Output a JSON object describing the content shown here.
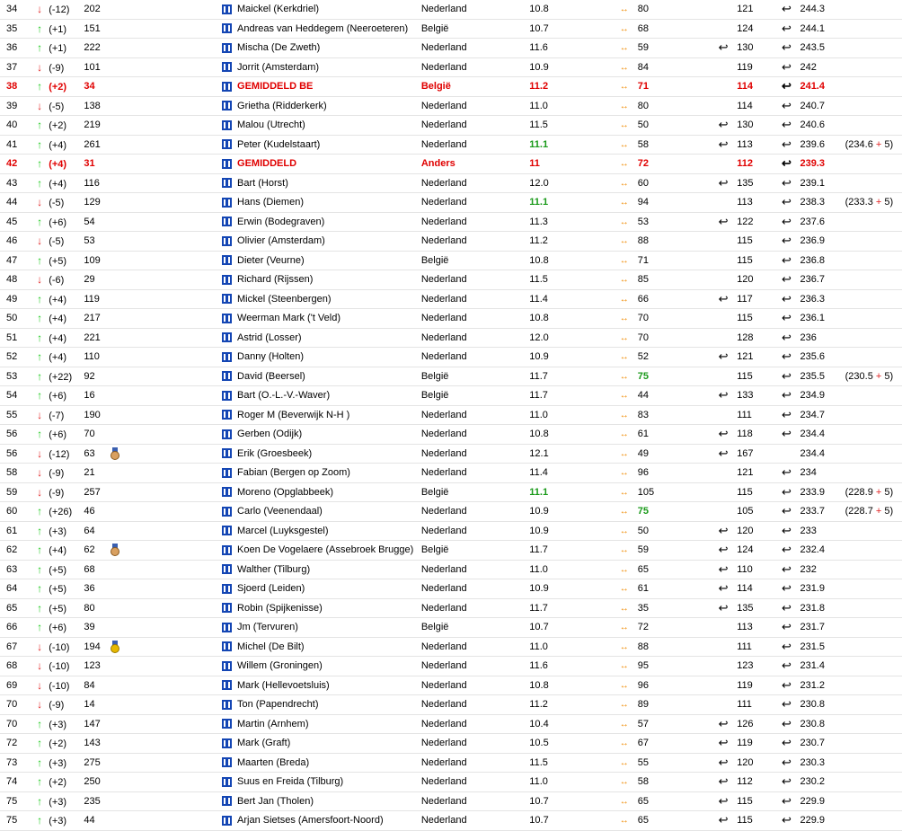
{
  "colors": {
    "up": "#19c819",
    "down": "#e02020",
    "highlight": "#e00000",
    "flag": "#1446b4",
    "swap": "#f08a00",
    "green_score": "#1a9a1a"
  },
  "icons": {
    "up": "↑",
    "down": "↓",
    "swap": "↔",
    "return": "↩"
  },
  "rows": [
    {
      "rank": "34",
      "dir": "down",
      "move": "(-12)",
      "id": "202",
      "medal": "",
      "name": "Maickel (Kerkdriel)",
      "country": "Nederland",
      "score": "10.8",
      "green": false,
      "v1": "80",
      "v1g": false,
      "r1": "",
      "v2": "121",
      "r2": "↩",
      "total": "244.3",
      "extra": "",
      "extra2": "",
      "hl": false
    },
    {
      "rank": "35",
      "dir": "up",
      "move": "(+1)",
      "id": "151",
      "medal": "",
      "name": "Andreas van Heddegem (Neeroeteren)",
      "country": "België",
      "score": "10.7",
      "green": false,
      "v1": "68",
      "v1g": false,
      "r1": "",
      "v2": "124",
      "r2": "↩",
      "total": "244.1",
      "extra": "",
      "extra2": "",
      "hl": false
    },
    {
      "rank": "36",
      "dir": "up",
      "move": "(+1)",
      "id": "222",
      "medal": "",
      "name": "Mischa (De Zweth)",
      "country": "Nederland",
      "score": "11.6",
      "green": false,
      "v1": "59",
      "v1g": false,
      "r1": "↩",
      "v2": "130",
      "r2": "↩",
      "total": "243.5",
      "extra": "",
      "extra2": "",
      "hl": false
    },
    {
      "rank": "37",
      "dir": "down",
      "move": "(-9)",
      "id": "101",
      "medal": "",
      "name": "Jorrit (Amsterdam)",
      "country": "Nederland",
      "score": "10.9",
      "green": false,
      "v1": "84",
      "v1g": false,
      "r1": "",
      "v2": "119",
      "r2": "↩",
      "total": "242",
      "extra": "",
      "extra2": "",
      "hl": false
    },
    {
      "rank": "38",
      "dir": "up",
      "move": "(+2)",
      "id": "34",
      "medal": "",
      "name": "GEMIDDELD BE",
      "country": "België",
      "score": "11.2",
      "green": false,
      "v1": "71",
      "v1g": false,
      "r1": "",
      "v2": "114",
      "r2": "↩",
      "total": "241.4",
      "extra": "",
      "extra2": "",
      "hl": true
    },
    {
      "rank": "39",
      "dir": "down",
      "move": "(-5)",
      "id": "138",
      "medal": "",
      "name": "Grietha (Ridderkerk)",
      "country": "Nederland",
      "score": "11.0",
      "green": false,
      "v1": "80",
      "v1g": false,
      "r1": "",
      "v2": "114",
      "r2": "↩",
      "total": "240.7",
      "extra": "",
      "extra2": "",
      "hl": false
    },
    {
      "rank": "40",
      "dir": "up",
      "move": "(+2)",
      "id": "219",
      "medal": "",
      "name": "Malou (Utrecht)",
      "country": "Nederland",
      "score": "11.5",
      "green": false,
      "v1": "50",
      "v1g": false,
      "r1": "↩",
      "v2": "130",
      "r2": "↩",
      "total": "240.6",
      "extra": "",
      "extra2": "",
      "hl": false
    },
    {
      "rank": "41",
      "dir": "up",
      "move": "(+4)",
      "id": "261",
      "medal": "",
      "name": "Peter (Kudelstaart)",
      "country": "Nederland",
      "score": "11.1",
      "green": true,
      "v1": "58",
      "v1g": false,
      "r1": "↩",
      "v2": "113",
      "r2": "↩",
      "total": "239.6",
      "extra": "(234.6",
      "extra2": "5)",
      "hl": false
    },
    {
      "rank": "42",
      "dir": "up",
      "move": "(+4)",
      "id": "31",
      "medal": "",
      "name": "GEMIDDELD",
      "country": "Anders",
      "score": "11",
      "green": false,
      "v1": "72",
      "v1g": false,
      "r1": "",
      "v2": "112",
      "r2": "↩",
      "total": "239.3",
      "extra": "",
      "extra2": "",
      "hl": true
    },
    {
      "rank": "43",
      "dir": "up",
      "move": "(+4)",
      "id": "116",
      "medal": "",
      "name": "Bart (Horst)",
      "country": "Nederland",
      "score": "12.0",
      "green": false,
      "v1": "60",
      "v1g": false,
      "r1": "↩",
      "v2": "135",
      "r2": "↩",
      "total": "239.1",
      "extra": "",
      "extra2": "",
      "hl": false
    },
    {
      "rank": "44",
      "dir": "down",
      "move": "(-5)",
      "id": "129",
      "medal": "",
      "name": "Hans (Diemen)",
      "country": "Nederland",
      "score": "11.1",
      "green": true,
      "v1": "94",
      "v1g": false,
      "r1": "",
      "v2": "113",
      "r2": "↩",
      "total": "238.3",
      "extra": "(233.3",
      "extra2": "5)",
      "hl": false
    },
    {
      "rank": "45",
      "dir": "up",
      "move": "(+6)",
      "id": "54",
      "medal": "",
      "name": "Erwin (Bodegraven)",
      "country": "Nederland",
      "score": "11.3",
      "green": false,
      "v1": "53",
      "v1g": false,
      "r1": "↩",
      "v2": "122",
      "r2": "↩",
      "total": "237.6",
      "extra": "",
      "extra2": "",
      "hl": false
    },
    {
      "rank": "46",
      "dir": "down",
      "move": "(-5)",
      "id": "53",
      "medal": "",
      "name": "Olivier (Amsterdam)",
      "country": "Nederland",
      "score": "11.2",
      "green": false,
      "v1": "88",
      "v1g": false,
      "r1": "",
      "v2": "115",
      "r2": "↩",
      "total": "236.9",
      "extra": "",
      "extra2": "",
      "hl": false
    },
    {
      "rank": "47",
      "dir": "up",
      "move": "(+5)",
      "id": "109",
      "medal": "",
      "name": "Dieter (Veurne)",
      "country": "België",
      "score": "10.8",
      "green": false,
      "v1": "71",
      "v1g": false,
      "r1": "",
      "v2": "115",
      "r2": "↩",
      "total": "236.8",
      "extra": "",
      "extra2": "",
      "hl": false
    },
    {
      "rank": "48",
      "dir": "down",
      "move": "(-6)",
      "id": "29",
      "medal": "",
      "name": "Richard (Rijssen)",
      "country": "Nederland",
      "score": "11.5",
      "green": false,
      "v1": "85",
      "v1g": false,
      "r1": "",
      "v2": "120",
      "r2": "↩",
      "total": "236.7",
      "extra": "",
      "extra2": "",
      "hl": false
    },
    {
      "rank": "49",
      "dir": "up",
      "move": "(+4)",
      "id": "119",
      "medal": "",
      "name": "Mickel (Steenbergen)",
      "country": "Nederland",
      "score": "11.4",
      "green": false,
      "v1": "66",
      "v1g": false,
      "r1": "↩",
      "v2": "117",
      "r2": "↩",
      "total": "236.3",
      "extra": "",
      "extra2": "",
      "hl": false
    },
    {
      "rank": "50",
      "dir": "up",
      "move": "(+4)",
      "id": "217",
      "medal": "",
      "name": "Weerman Mark ('t Veld)",
      "country": "Nederland",
      "score": "10.8",
      "green": false,
      "v1": "70",
      "v1g": false,
      "r1": "",
      "v2": "115",
      "r2": "↩",
      "total": "236.1",
      "extra": "",
      "extra2": "",
      "hl": false
    },
    {
      "rank": "51",
      "dir": "up",
      "move": "(+4)",
      "id": "221",
      "medal": "",
      "name": "Astrid (Losser)",
      "country": "Nederland",
      "score": "12.0",
      "green": false,
      "v1": "70",
      "v1g": false,
      "r1": "",
      "v2": "128",
      "r2": "↩",
      "total": "236",
      "extra": "",
      "extra2": "",
      "hl": false
    },
    {
      "rank": "52",
      "dir": "up",
      "move": "(+4)",
      "id": "110",
      "medal": "",
      "name": "Danny (Holten)",
      "country": "Nederland",
      "score": "10.9",
      "green": false,
      "v1": "52",
      "v1g": false,
      "r1": "↩",
      "v2": "121",
      "r2": "↩",
      "total": "235.6",
      "extra": "",
      "extra2": "",
      "hl": false
    },
    {
      "rank": "53",
      "dir": "up",
      "move": "(+22)",
      "id": "92",
      "medal": "",
      "name": "David (Beersel)",
      "country": "België",
      "score": "11.7",
      "green": false,
      "v1": "75",
      "v1g": true,
      "r1": "",
      "v2": "115",
      "r2": "↩",
      "total": "235.5",
      "extra": "(230.5",
      "extra2": "5)",
      "hl": false
    },
    {
      "rank": "54",
      "dir": "up",
      "move": "(+6)",
      "id": "16",
      "medal": "",
      "name": "Bart (O.-L.-V.-Waver)",
      "country": "België",
      "score": "11.7",
      "green": false,
      "v1": "44",
      "v1g": false,
      "r1": "↩",
      "v2": "133",
      "r2": "↩",
      "total": "234.9",
      "extra": "",
      "extra2": "",
      "hl": false
    },
    {
      "rank": "55",
      "dir": "down",
      "move": "(-7)",
      "id": "190",
      "medal": "",
      "name": "Roger M (Beverwijk N-H )",
      "country": "Nederland",
      "score": "11.0",
      "green": false,
      "v1": "83",
      "v1g": false,
      "r1": "",
      "v2": "111",
      "r2": "↩",
      "total": "234.7",
      "extra": "",
      "extra2": "",
      "hl": false
    },
    {
      "rank": "56",
      "dir": "up",
      "move": "(+6)",
      "id": "70",
      "medal": "",
      "name": "Gerben (Odijk)",
      "country": "Nederland",
      "score": "10.8",
      "green": false,
      "v1": "61",
      "v1g": false,
      "r1": "↩",
      "v2": "118",
      "r2": "↩",
      "total": "234.4",
      "extra": "",
      "extra2": "",
      "hl": false
    },
    {
      "rank": "56",
      "dir": "down",
      "move": "(-12)",
      "id": "63",
      "medal": "bronze",
      "name": "Erik (Groesbeek)",
      "country": "Nederland",
      "score": "12.1",
      "green": false,
      "v1": "49",
      "v1g": false,
      "r1": "↩",
      "v2": "167",
      "r2": "",
      "total": "234.4",
      "extra": "",
      "extra2": "",
      "hl": false
    },
    {
      "rank": "58",
      "dir": "down",
      "move": "(-9)",
      "id": "21",
      "medal": "",
      "name": "Fabian (Bergen op Zoom)",
      "country": "Nederland",
      "score": "11.4",
      "green": false,
      "v1": "96",
      "v1g": false,
      "r1": "",
      "v2": "121",
      "r2": "↩",
      "total": "234",
      "extra": "",
      "extra2": "",
      "hl": false
    },
    {
      "rank": "59",
      "dir": "down",
      "move": "(-9)",
      "id": "257",
      "medal": "",
      "name": "Moreno (Opglabbeek)",
      "country": "België",
      "score": "11.1",
      "green": true,
      "v1": "105",
      "v1g": false,
      "r1": "",
      "v2": "115",
      "r2": "↩",
      "total": "233.9",
      "extra": "(228.9",
      "extra2": "5)",
      "hl": false
    },
    {
      "rank": "60",
      "dir": "up",
      "move": "(+26)",
      "id": "46",
      "medal": "",
      "name": "Carlo (Veenendaal)",
      "country": "Nederland",
      "score": "10.9",
      "green": false,
      "v1": "75",
      "v1g": true,
      "r1": "",
      "v2": "105",
      "r2": "↩",
      "total": "233.7",
      "extra": "(228.7",
      "extra2": "5)",
      "hl": false
    },
    {
      "rank": "61",
      "dir": "up",
      "move": "(+3)",
      "id": "64",
      "medal": "",
      "name": "Marcel (Luyksgestel)",
      "country": "Nederland",
      "score": "10.9",
      "green": false,
      "v1": "50",
      "v1g": false,
      "r1": "↩",
      "v2": "120",
      "r2": "↩",
      "total": "233",
      "extra": "",
      "extra2": "",
      "hl": false
    },
    {
      "rank": "62",
      "dir": "up",
      "move": "(+4)",
      "id": "62",
      "medal": "bronze",
      "name": "Koen De Vogelaere (Assebroek Brugge)",
      "country": "België",
      "score": "11.7",
      "green": false,
      "v1": "59",
      "v1g": false,
      "r1": "↩",
      "v2": "124",
      "r2": "↩",
      "total": "232.4",
      "extra": "",
      "extra2": "",
      "hl": false
    },
    {
      "rank": "63",
      "dir": "up",
      "move": "(+5)",
      "id": "68",
      "medal": "",
      "name": "Walther (Tilburg)",
      "country": "Nederland",
      "score": "11.0",
      "green": false,
      "v1": "65",
      "v1g": false,
      "r1": "↩",
      "v2": "110",
      "r2": "↩",
      "total": "232",
      "extra": "",
      "extra2": "",
      "hl": false
    },
    {
      "rank": "64",
      "dir": "up",
      "move": "(+5)",
      "id": "36",
      "medal": "",
      "name": "Sjoerd (Leiden)",
      "country": "Nederland",
      "score": "10.9",
      "green": false,
      "v1": "61",
      "v1g": false,
      "r1": "↩",
      "v2": "114",
      "r2": "↩",
      "total": "231.9",
      "extra": "",
      "extra2": "",
      "hl": false
    },
    {
      "rank": "65",
      "dir": "up",
      "move": "(+5)",
      "id": "80",
      "medal": "",
      "name": "Robin (Spijkenisse)",
      "country": "Nederland",
      "score": "11.7",
      "green": false,
      "v1": "35",
      "v1g": false,
      "r1": "↩",
      "v2": "135",
      "r2": "↩",
      "total": "231.8",
      "extra": "",
      "extra2": "",
      "hl": false
    },
    {
      "rank": "66",
      "dir": "up",
      "move": "(+6)",
      "id": "39",
      "medal": "",
      "name": "Jm (Tervuren)",
      "country": "België",
      "score": "10.7",
      "green": false,
      "v1": "72",
      "v1g": false,
      "r1": "",
      "v2": "113",
      "r2": "↩",
      "total": "231.7",
      "extra": "",
      "extra2": "",
      "hl": false
    },
    {
      "rank": "67",
      "dir": "down",
      "move": "(-10)",
      "id": "194",
      "medal": "gold",
      "name": "Michel (De Bilt)",
      "country": "Nederland",
      "score": "11.0",
      "green": false,
      "v1": "88",
      "v1g": false,
      "r1": "",
      "v2": "111",
      "r2": "↩",
      "total": "231.5",
      "extra": "",
      "extra2": "",
      "hl": false
    },
    {
      "rank": "68",
      "dir": "down",
      "move": "(-10)",
      "id": "123",
      "medal": "",
      "name": "Willem (Groningen)",
      "country": "Nederland",
      "score": "11.6",
      "green": false,
      "v1": "95",
      "v1g": false,
      "r1": "",
      "v2": "123",
      "r2": "↩",
      "total": "231.4",
      "extra": "",
      "extra2": "",
      "hl": false
    },
    {
      "rank": "69",
      "dir": "down",
      "move": "(-10)",
      "id": "84",
      "medal": "",
      "name": "Mark (Hellevoetsluis)",
      "country": "Nederland",
      "score": "10.8",
      "green": false,
      "v1": "96",
      "v1g": false,
      "r1": "",
      "v2": "119",
      "r2": "↩",
      "total": "231.2",
      "extra": "",
      "extra2": "",
      "hl": false
    },
    {
      "rank": "70",
      "dir": "down",
      "move": "(-9)",
      "id": "14",
      "medal": "",
      "name": "Ton (Papendrecht)",
      "country": "Nederland",
      "score": "11.2",
      "green": false,
      "v1": "89",
      "v1g": false,
      "r1": "",
      "v2": "111",
      "r2": "↩",
      "total": "230.8",
      "extra": "",
      "extra2": "",
      "hl": false
    },
    {
      "rank": "70",
      "dir": "up",
      "move": "(+3)",
      "id": "147",
      "medal": "",
      "name": "Martin (Arnhem)",
      "country": "Nederland",
      "score": "10.4",
      "green": false,
      "v1": "57",
      "v1g": false,
      "r1": "↩",
      "v2": "126",
      "r2": "↩",
      "total": "230.8",
      "extra": "",
      "extra2": "",
      "hl": false
    },
    {
      "rank": "72",
      "dir": "up",
      "move": "(+2)",
      "id": "143",
      "medal": "",
      "name": "Mark (Graft)",
      "country": "Nederland",
      "score": "10.5",
      "green": false,
      "v1": "67",
      "v1g": false,
      "r1": "↩",
      "v2": "119",
      "r2": "↩",
      "total": "230.7",
      "extra": "",
      "extra2": "",
      "hl": false
    },
    {
      "rank": "73",
      "dir": "up",
      "move": "(+3)",
      "id": "275",
      "medal": "",
      "name": "Maarten (Breda)",
      "country": "Nederland",
      "score": "11.5",
      "green": false,
      "v1": "55",
      "v1g": false,
      "r1": "↩",
      "v2": "120",
      "r2": "↩",
      "total": "230.3",
      "extra": "",
      "extra2": "",
      "hl": false
    },
    {
      "rank": "74",
      "dir": "up",
      "move": "(+2)",
      "id": "250",
      "medal": "",
      "name": "Suus en Freida (Tilburg)",
      "country": "Nederland",
      "score": "11.0",
      "green": false,
      "v1": "58",
      "v1g": false,
      "r1": "↩",
      "v2": "112",
      "r2": "↩",
      "total": "230.2",
      "extra": "",
      "extra2": "",
      "hl": false
    },
    {
      "rank": "75",
      "dir": "up",
      "move": "(+3)",
      "id": "235",
      "medal": "",
      "name": "Bert Jan (Tholen)",
      "country": "Nederland",
      "score": "10.7",
      "green": false,
      "v1": "65",
      "v1g": false,
      "r1": "↩",
      "v2": "115",
      "r2": "↩",
      "total": "229.9",
      "extra": "",
      "extra2": "",
      "hl": false
    },
    {
      "rank": "75",
      "dir": "up",
      "move": "(+3)",
      "id": "44",
      "medal": "",
      "name": "Arjan Sietses (Amersfoort-Noord)",
      "country": "Nederland",
      "score": "10.7",
      "green": false,
      "v1": "65",
      "v1g": false,
      "r1": "↩",
      "v2": "115",
      "r2": "↩",
      "total": "229.9",
      "extra": "",
      "extra2": "",
      "hl": false
    }
  ]
}
